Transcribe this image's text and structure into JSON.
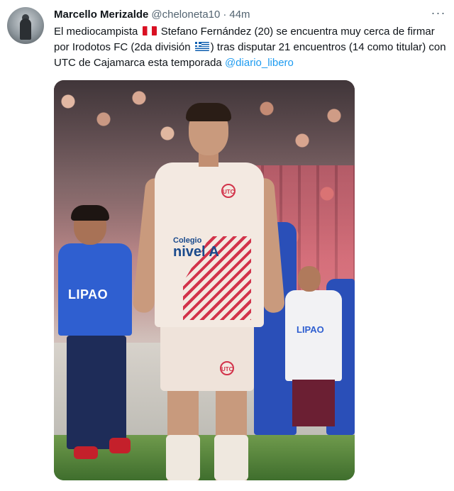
{
  "tweet": {
    "author_name": "Marcello Merizalde",
    "handle": "@cheloneta10",
    "separator": "·",
    "time": "44m",
    "more_label": "···",
    "text_part1": "El mediocampista",
    "text_part2": "Stefano Fernández (20) se encuentra muy cerca de firmar por Irodotos FC (2da división",
    "text_part3": ") tras disputar 21 encuentros (14 como titular) con UTC de Cajamarca esta temporada",
    "mention": "@diario_libero",
    "flag_1": "peru-flag-icon",
    "flag_2": "greece-flag-icon"
  },
  "photo": {
    "main_sponsor_small": "Colegio",
    "main_sponsor_big": "nivel A",
    "kid_shirt_text": "LIPAO",
    "kid2_shirt_text": "LIPAO",
    "club_badge": "UTC"
  },
  "colors": {
    "mention": "#1d9bf0",
    "text": "#0f1419",
    "muted": "#536471"
  }
}
